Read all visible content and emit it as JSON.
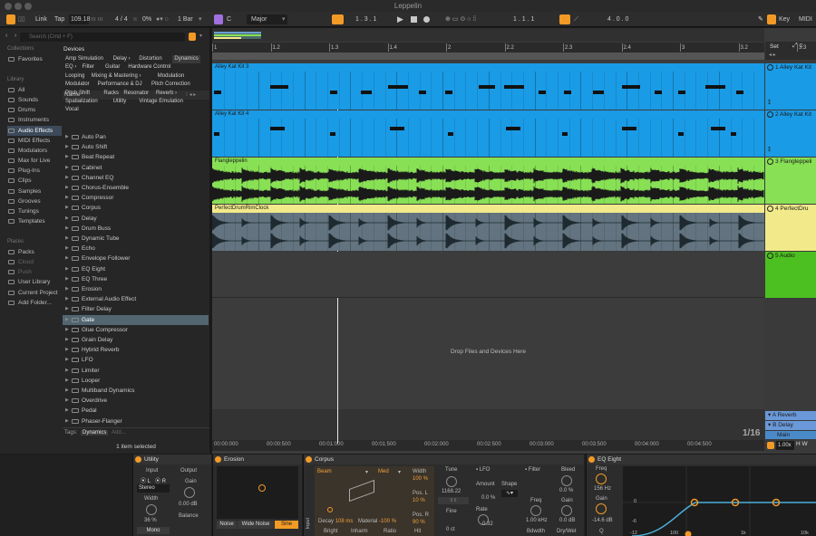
{
  "window": {
    "title": "Leppelin"
  },
  "control_bar": {
    "link": "Link",
    "tap": "Tap",
    "tempo": "109.18",
    "time_sig": "4 / 4",
    "cpu": "0%",
    "quantize": "1 Bar",
    "key_root": "C",
    "scale": "Major",
    "position": "1 . 3 . 1",
    "loop_start": "1 . 1 . 1",
    "loop_length": "4 . 0 . 0",
    "key_btn": "Key",
    "midi_btn": "MIDI"
  },
  "browser": {
    "search_placeholder": "Search (Cmd + F)",
    "collections_head": "Collections",
    "collections": [
      "Favorites"
    ],
    "library_head": "Library",
    "library": [
      "All",
      "Sounds",
      "Drums",
      "Instruments",
      "Audio Effects",
      "MIDI Effects",
      "Modulators",
      "Max for Live",
      "Plug-Ins",
      "Clips",
      "Samples",
      "Grooves",
      "Tunings",
      "Templates"
    ],
    "places_head": "Places",
    "places": [
      "Packs",
      "Cloud",
      "Push",
      "User Library",
      "Current Project",
      "Add Folder..."
    ],
    "devices_label": "Devices",
    "tag_rows": [
      [
        "Amp Simulation",
        "Delay ›",
        "Distortion",
        "Dynamics"
      ],
      [
        "EQ ›",
        "Filter",
        "Guitar",
        "Hardware Control"
      ],
      [
        "Looping",
        "Mixing & Mastering ›",
        "Modulation"
      ],
      [
        "Modulator",
        "Performance & DJ",
        "Pitch Correction"
      ],
      [
        "Pitch Shift",
        "Racks",
        "Resonator",
        "Reverb ›"
      ],
      [
        "Spatialization",
        "Utility",
        "Vintage Emulation"
      ],
      [
        "Vocal"
      ]
    ],
    "name_header": "Name",
    "items": [
      "Auto Pan",
      "Auto Shift",
      "Beat Repeat",
      "Cabinet",
      "Channel EQ",
      "Chorus-Ensemble",
      "Compressor",
      "Corpus",
      "Delay",
      "Drum Buss",
      "Dynamic Tube",
      "Echo",
      "Envelope Follower",
      "EQ Eight",
      "EQ Three",
      "Erosion",
      "External Audio Effect",
      "Filter Delay",
      "Gate",
      "Glue Compressor",
      "Grain Delay",
      "Hybrid Reverb",
      "LFO",
      "Limiter",
      "Looper",
      "Multiband Dynamics",
      "Overdrive",
      "Pedal",
      "Phaser-Flanger"
    ],
    "selected_item": "Gate",
    "tags_label": "Tags:",
    "tags_value": "Dynamics",
    "tags_add": "Add...",
    "selection_status": "1 item selected"
  },
  "arrangement": {
    "ruler": [
      "1",
      "1.2",
      "1.3",
      "1.4",
      "2",
      "2.2",
      "2.3",
      "2.4",
      "3",
      "3.2",
      "3.3"
    ],
    "set_label": "Set",
    "clips": [
      {
        "name": "Alley Kat Kit 3",
        "color": "#1a9be6"
      },
      {
        "name": "Alley Kat Kit 4",
        "color": "#1a9be6"
      },
      {
        "name": "Flangleppelin",
        "color": "#88e055"
      },
      {
        "name": "PerfectDrumRimClock",
        "color": "#f2ea8a"
      }
    ],
    "tracks": [
      {
        "num": "1",
        "name": "Alley Kat Kit",
        "color": "#1a9be6"
      },
      {
        "num": "2",
        "name": "Alley Kat Kit",
        "color": "#1a9be6"
      },
      {
        "num": "3",
        "name": "Flangleppeli",
        "color": "#88e055"
      },
      {
        "num": "4",
        "name": "PerfectDru",
        "color": "#f2ea8a"
      },
      {
        "num": "5",
        "name": "Audio",
        "color": "#4cc020"
      }
    ],
    "drop_text": "Drop Files and Devices Here",
    "returns": [
      {
        "letter": "A",
        "name": "Reverb"
      },
      {
        "letter": "B",
        "name": "Delay"
      }
    ],
    "main_label": "Main",
    "zoom": "1/16",
    "times": [
      "00:00:000",
      "00:00:500",
      "00:01:000",
      "00:01:500",
      "00:02:000",
      "00:02:500",
      "00:03:000",
      "00:03:500",
      "00:04:000",
      "00:04:500"
    ],
    "zoom_factor": "1.00x"
  },
  "devices": {
    "utility": {
      "title": "Utility",
      "input": "Input",
      "output": "Output",
      "ch_l": "L",
      "ch_r": "R",
      "stereo": "Stereo",
      "gain": "Gain",
      "gain_val": "0.00 dB",
      "width": "Width",
      "width_val": "36 %",
      "balance": "Balance",
      "mono": "Mono"
    },
    "erosion": {
      "title": "Erosion",
      "modes": [
        "Noise",
        "Wide Noise",
        "Sine"
      ]
    },
    "corpus": {
      "title": "Corpus",
      "type": "Beam",
      "quality": "Med",
      "width": "Width",
      "width_val": "100 %",
      "pos_l": "Pos. L",
      "pos_l_val": "10 %",
      "pos_r": "Pos. R",
      "pos_r_val": "90 %",
      "decay": "Decay",
      "decay_val": "108 ms",
      "material": "Material",
      "material_val": "-100 %",
      "bright": "Bright",
      "inharm": "Inharm",
      "ratio": "Ratio",
      "hit": "Hit",
      "tune": "Tune",
      "tune_val": "1168.22",
      "fine": "Fine",
      "fine_val": "0 ct",
      "lfo": "LFO",
      "amount": "Amount",
      "amount_val": "0.0 %",
      "shape": "Shape",
      "rate": "Rate",
      "rate_val": "0.32",
      "filter": "Filter",
      "bleed": "Bleed",
      "bleed_val": "0.0 %",
      "freq": "Freq",
      "freq_val": "1.00 kHz",
      "bdwdth": "Bdwdth",
      "gain": "Gain",
      "gain_val": "0.0 dB",
      "drywet": "Dry/Wet",
      "input_label": "Input"
    },
    "eq_eight": {
      "title": "EQ Eight",
      "freq": "Freq",
      "freq_val": "156 Hz",
      "gain": "Gain",
      "gain_val": "-14.6 dB",
      "q": "Q",
      "scale_vals": [
        "0",
        "-6",
        "-12"
      ],
      "freq_marks": [
        "100",
        "1k",
        "10k"
      ]
    }
  }
}
